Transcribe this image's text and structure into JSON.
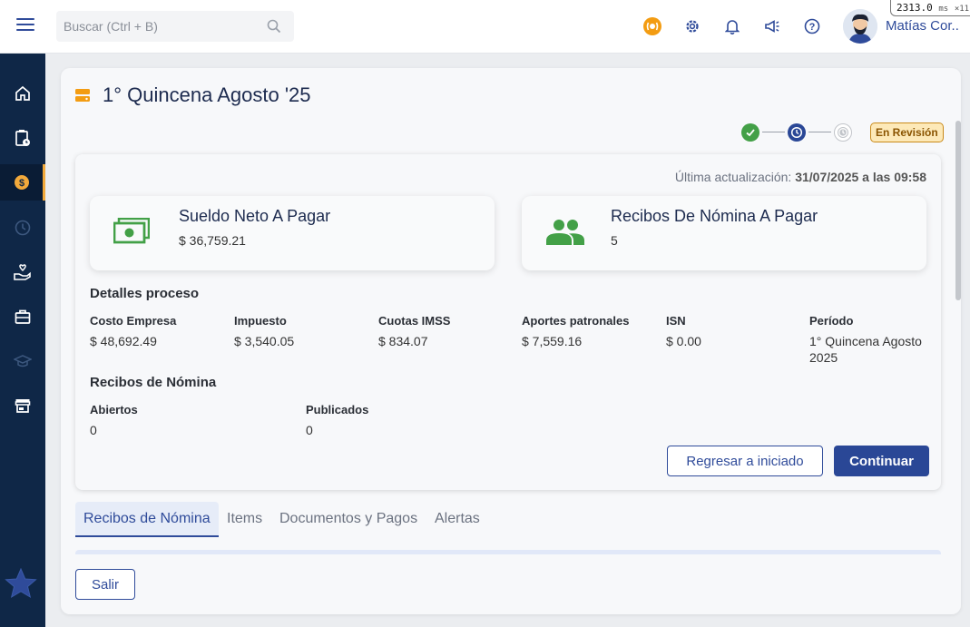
{
  "header": {
    "search_placeholder": "Buscar (Ctrl + B)",
    "user_name": "Matías Cor...",
    "perf_value": "2313.0",
    "perf_unit": "ms",
    "perf_mult": "×11"
  },
  "page": {
    "title": "1° Quincena Agosto '25",
    "status": "En Revisión",
    "last_update_label": "Última actualización:",
    "last_update_value": "31/07/2025 a las 09:58"
  },
  "stats": [
    {
      "title": "Sueldo Neto A Pagar",
      "value": "$ 36,759.21",
      "icon": "money-icon"
    },
    {
      "title": "Recibos De Nómina A Pagar",
      "value": "5",
      "icon": "people-icon"
    }
  ],
  "details": {
    "title": "Detalles proceso",
    "items": [
      {
        "label": "Costo Empresa",
        "value": "$ 48,692.49"
      },
      {
        "label": "Impuesto",
        "value": "$ 3,540.05"
      },
      {
        "label": "Cuotas IMSS",
        "value": "$ 834.07"
      },
      {
        "label": "Aportes patronales",
        "value": "$ 7,559.16"
      },
      {
        "label": "ISN",
        "value": "$ 0.00"
      },
      {
        "label": "Período",
        "value": "1° Quincena Agosto 2025"
      }
    ]
  },
  "receipts": {
    "title": "Recibos de Nómina",
    "items": [
      {
        "label": "Abiertos",
        "value": "0"
      },
      {
        "label": "Publicados",
        "value": "0"
      }
    ]
  },
  "actions": {
    "back_label": "Regresar a iniciado",
    "continue_label": "Continuar",
    "exit_label": "Salir"
  },
  "tabs": [
    {
      "label": "Recibos de Nómina",
      "active": true
    },
    {
      "label": "Items",
      "active": false
    },
    {
      "label": "Documentos y Pagos",
      "active": false
    },
    {
      "label": "Alertas",
      "active": false
    }
  ],
  "colors": {
    "sidebar": "#0f2747",
    "accent": "#2a4796",
    "active_indicator": "#f2a93b",
    "success": "#43a047",
    "status_bg": "#fde9b8"
  }
}
